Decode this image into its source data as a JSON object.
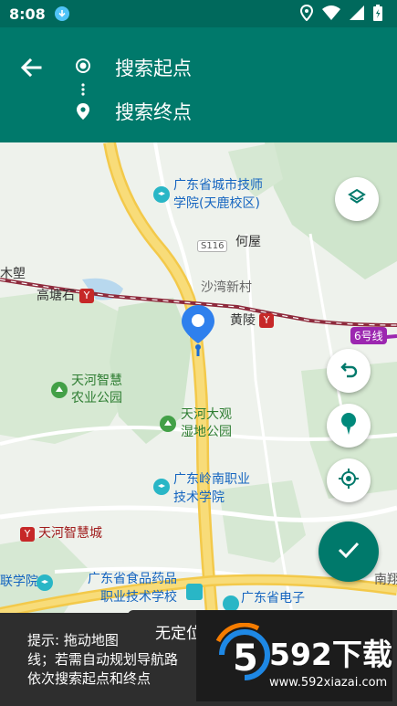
{
  "status_bar": {
    "time": "8:08",
    "icons": [
      "download-icon",
      "location-icon",
      "wifi-icon",
      "signal-icon",
      "battery-icon"
    ]
  },
  "header": {
    "start_placeholder": "搜索起点",
    "end_placeholder": "搜索终点",
    "accent_color": "#00796b"
  },
  "map": {
    "labels": {
      "poi_1a": "广东省城市技师",
      "poi_1b": "学院(天鹿校区)",
      "hewu": "何屋",
      "road_s116": "S116",
      "shawan": "沙湾新村",
      "mulong": "木塱",
      "gaotangshi": "高塘石",
      "huangling": "黄陵",
      "line6": "6号线",
      "agri_a": "天河智慧",
      "agri_b": "农业公园",
      "wetland_a": "天河大观",
      "wetland_b": "湿地公园",
      "lingnan_a": "广东岭南职业",
      "lingnan_b": "技术学院",
      "smartcity": "天河智慧城",
      "school_frag": "联学院",
      "food_a": "广东省食品药品",
      "food_b": "职业技术学校",
      "elec": "广东省电子",
      "nanxiang": "南翔"
    }
  },
  "buttons": {
    "layers": "layers-icon",
    "undo": "undo-icon",
    "pin": "pin-icon",
    "locate": "gps-locate-icon",
    "confirm": "check-icon"
  },
  "bottom": {
    "no_location": "无定位",
    "hint_1": "提示: 拖动地图",
    "hint_2": "线；若需自动规划导航路",
    "hint_3": "依次搜索起点和终点"
  },
  "watermark": {
    "title": "592下载",
    "url": "www.592xiazai.com"
  }
}
